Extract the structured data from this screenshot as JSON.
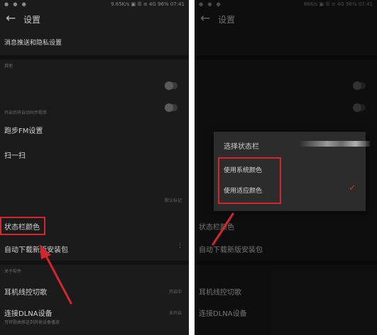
{
  "left": {
    "status": {
      "left": "● ● ●",
      "right": "9.65K/s ▣ ☰ ≡ 4G 96% 07:41"
    },
    "title": "设置",
    "rows": {
      "privacy": "消息推送和隐私设置",
      "section1": "其他",
      "sub1": "开启后将自动同步歌单",
      "fm": "跑步FM设置",
      "scan": "扫一扫",
      "theme_value": "默认标记",
      "statusbar_color": "状态栏颜色",
      "auto_update": "自动下载新版安装包",
      "section2": "关于软件",
      "headset": "耳机线控切歌",
      "headset_value": "开启中",
      "dlna": "连接DLNA设备",
      "dlna_value": "未开启",
      "dlna_sub": "可将歌曲推送到其他设备播放"
    }
  },
  "right": {
    "status": {
      "left": "● ● ●",
      "right": "866/s ▣ ☰ ≡ 4G 96% 07:41"
    },
    "title": "设置",
    "dialog": {
      "title": "选择状态栏",
      "options": [
        "使用系统颜色",
        "使用适应颜色"
      ],
      "selected_index": 1,
      "check_icon": "✓"
    },
    "bg_rows": {
      "statusbar_color": "状态栏颜色",
      "auto_update": "自动下载新版安装包",
      "headset": "耳机线控切歌",
      "dlna": "连接DLNA设备"
    }
  },
  "colors": {
    "highlight": "#d3262e",
    "background": "#1b1b1b",
    "dialog": "#2c2c2c"
  },
  "icons": {
    "back": "back-arrow-icon",
    "more": "more-dots-icon",
    "check": "check-icon"
  }
}
